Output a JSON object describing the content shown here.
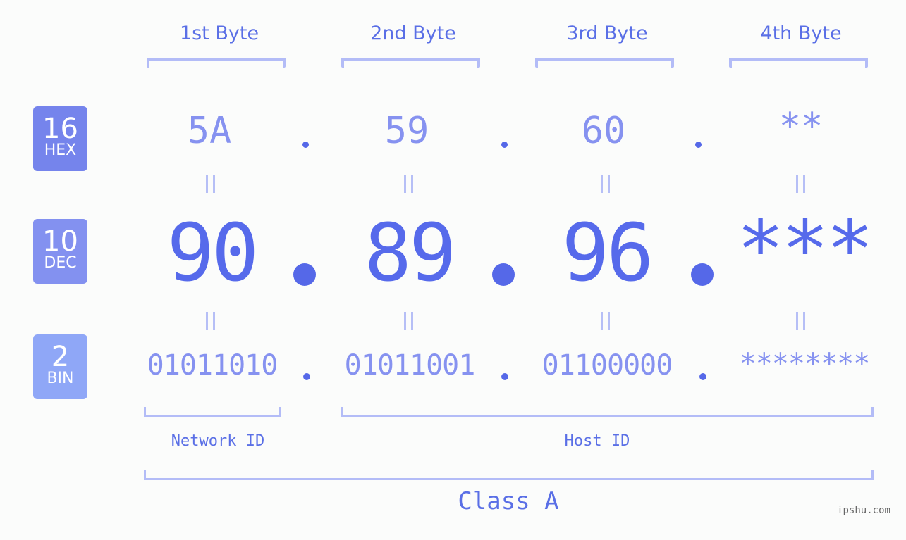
{
  "headers": [
    "1st Byte",
    "2nd Byte",
    "3rd Byte",
    "4th Byte"
  ],
  "badges": {
    "hex": {
      "num": "16",
      "label": "HEX",
      "color": "#7584ec"
    },
    "dec": {
      "num": "10",
      "label": "DEC",
      "color": "#8391f0"
    },
    "bin": {
      "num": "2",
      "label": "BIN",
      "color": "#8fa7f7"
    }
  },
  "hex": [
    "5A",
    "59",
    "60",
    "**"
  ],
  "dec": [
    "90",
    "89",
    "96",
    "***"
  ],
  "bin": [
    "01011010",
    "01011001",
    "01100000",
    "********"
  ],
  "network_label": "Network ID",
  "host_label": "Host ID",
  "class_label": "Class A",
  "watermark": "ipshu.com",
  "colors": {
    "accent": "#566aeb",
    "light": "#8692f0",
    "bracket": "#b3bcf7"
  }
}
